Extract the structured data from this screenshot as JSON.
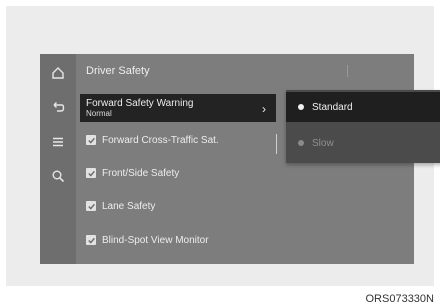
{
  "header": {
    "title": "Driver Safety"
  },
  "sidebar": {
    "icons": [
      "home-icon",
      "back-icon",
      "menu-icon",
      "search-icon"
    ]
  },
  "menu": {
    "selected_item": {
      "label": "Forward Safety Warning",
      "value": "Normal"
    },
    "items": [
      {
        "label": "Forward Cross-Traffic Sat.",
        "checked": true
      },
      {
        "label": "Front/Side Safety",
        "checked": true
      },
      {
        "label": "Lane Safety",
        "checked": true
      },
      {
        "label": "Blind-Spot View Monitor",
        "checked": true
      }
    ]
  },
  "popup": {
    "options": [
      {
        "label": "Standard",
        "selected": true
      },
      {
        "label": "Slow",
        "selected": false
      }
    ]
  },
  "caption": "ORS073330N",
  "colors": {
    "screen": "#7d7d7d",
    "selected_bg": "#232323",
    "popup_bg": "#4b4b4b"
  }
}
